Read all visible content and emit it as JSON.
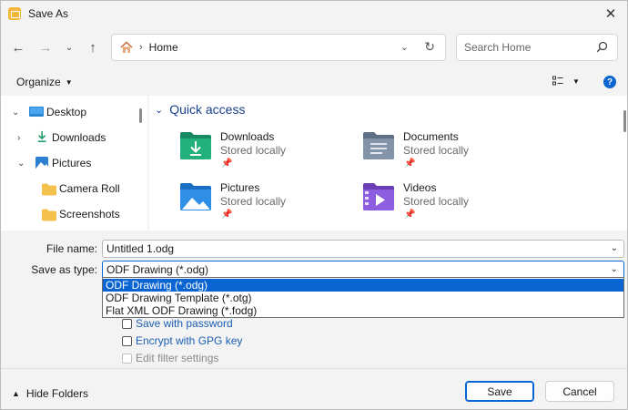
{
  "window": {
    "title": "Save As"
  },
  "nav": {
    "breadcrumb": "Home",
    "search_placeholder": "Search Home"
  },
  "toolbar": {
    "organize_label": "Organize"
  },
  "tree": {
    "items": [
      {
        "label": "Desktop",
        "icon": "desktop-icon",
        "expanded": true
      },
      {
        "label": "Downloads",
        "icon": "downloads-icon",
        "expanded": false
      },
      {
        "label": "Pictures",
        "icon": "pictures-icon",
        "expanded": true
      },
      {
        "label": "Camera Roll",
        "icon": "folder-icon"
      },
      {
        "label": "Screenshots",
        "icon": "folder-icon"
      }
    ]
  },
  "quick_access": {
    "header": "Quick access",
    "items": [
      {
        "name": "Downloads",
        "status": "Stored locally",
        "icon": "downloads-folder-icon"
      },
      {
        "name": "Documents",
        "status": "Stored locally",
        "icon": "documents-folder-icon"
      },
      {
        "name": "Pictures",
        "status": "Stored locally",
        "icon": "pictures-folder-icon"
      },
      {
        "name": "Videos",
        "status": "Stored locally",
        "icon": "videos-folder-icon"
      }
    ]
  },
  "form": {
    "filename_label": "File name:",
    "filename_value": "Untitled 1.odg",
    "savetype_label": "Save as type:",
    "savetype_value": "ODF Drawing (*.odg)",
    "savetype_options": [
      "ODF Drawing (*.odg)",
      "ODF Drawing Template (*.otg)",
      "Flat XML ODF Drawing (*.fodg)"
    ],
    "checks": [
      {
        "label": "Save with password",
        "enabled": true
      },
      {
        "label": "Encrypt with GPG key",
        "enabled": true
      },
      {
        "label": "Edit filter settings",
        "enabled": false
      }
    ]
  },
  "footer": {
    "hide_folders": "Hide Folders",
    "save_label": "Save",
    "cancel_label": "Cancel"
  },
  "colors": {
    "accent": "#0a64d2",
    "link": "#1a5fb4",
    "header": "#1a3e8a"
  }
}
